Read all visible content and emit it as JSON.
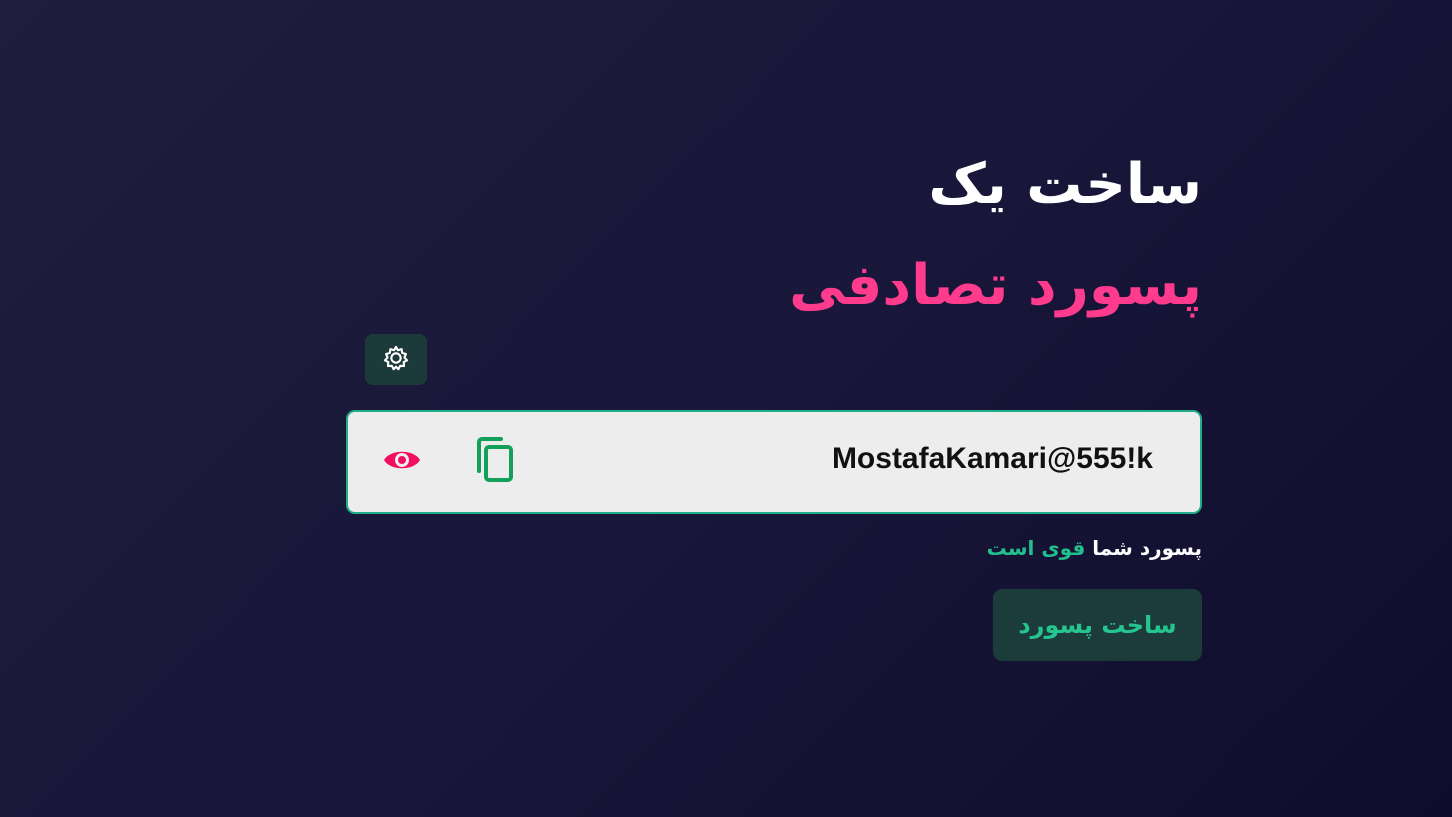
{
  "header": {
    "title_line1": "ساخت یک",
    "title_line2": "پسورد تصادفی"
  },
  "settings": {
    "icon": "gear-icon"
  },
  "password": {
    "value": "MostafaKamari@555!k",
    "copy_icon": "copy-icon",
    "show_icon": "eye-icon"
  },
  "strength": {
    "prefix": "پسورد شما",
    "level": "قوی است"
  },
  "generate": {
    "label": "ساخت پسورد"
  },
  "colors": {
    "accent_pink": "#ff3b8d",
    "accent_green": "#21c08e",
    "background": "#19173a",
    "button_bg": "#1b3c3b"
  }
}
